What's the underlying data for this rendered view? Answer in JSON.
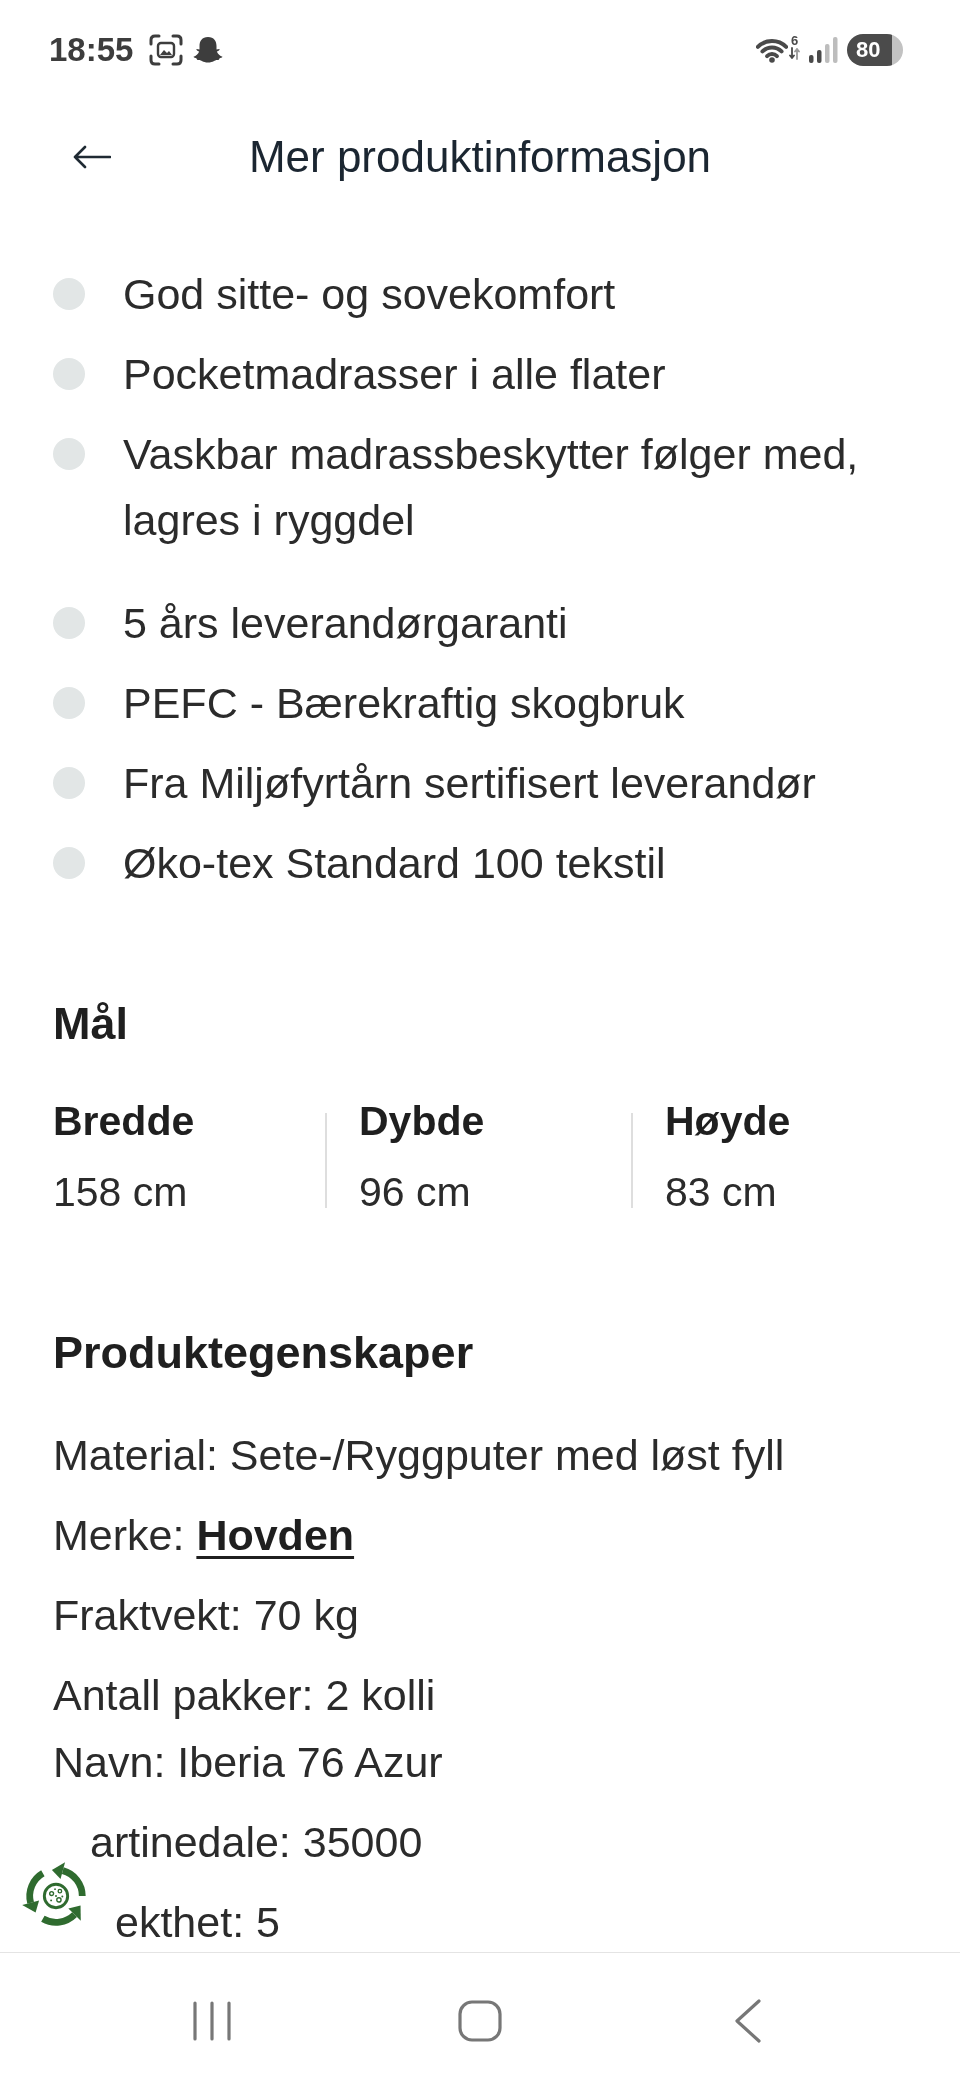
{
  "status_bar": {
    "time": "18:55",
    "wifi_standard": "6",
    "battery": "80"
  },
  "header": {
    "title": "Mer produktinformasjon"
  },
  "feature_lists": [
    {
      "items": [
        "God sitte- og sovekomfort",
        "Pocketmadrasser i alle flater",
        "Vaskbar madrassbeskytter følger med, lagres i ryggdel"
      ]
    },
    {
      "items": [
        "5 års leverandørgaranti",
        "PEFC - Bærekraftig skogbruk",
        "Fra Miljøfyrtårn sertifisert leverandør",
        "Øko-tex Standard 100 tekstil"
      ]
    }
  ],
  "dimensions": {
    "title": "Mål",
    "items": [
      {
        "label": "Bredde",
        "value": "158 cm"
      },
      {
        "label": "Dybde",
        "value": "96 cm"
      },
      {
        "label": "Høyde",
        "value": "83 cm"
      }
    ]
  },
  "properties": {
    "title": "Produktegenskaper",
    "groups": [
      {
        "lines": [
          {
            "label": "Material:",
            "value": "Sete-/Ryggputer med løst fyll",
            "kind": "text"
          }
        ]
      },
      {
        "lines": [
          {
            "label": "Merke:",
            "value": "Hovden",
            "kind": "link"
          }
        ]
      },
      {
        "lines": [
          {
            "label": "Fraktvekt:",
            "value": "70 kg",
            "kind": "text"
          }
        ]
      },
      {
        "lines": [
          {
            "label": "Antall pakker:",
            "value": "2 kolli",
            "kind": "text"
          },
          {
            "label": "Navn:",
            "value": "Iberia 76 Azur",
            "kind": "text"
          }
        ]
      },
      {
        "lines": [
          {
            "label": "artinedale:",
            "value": "35000",
            "kind": "text"
          }
        ]
      },
      {
        "lines": [
          {
            "label": "ekthet:",
            "value": "5",
            "kind": "text"
          }
        ]
      }
    ]
  }
}
